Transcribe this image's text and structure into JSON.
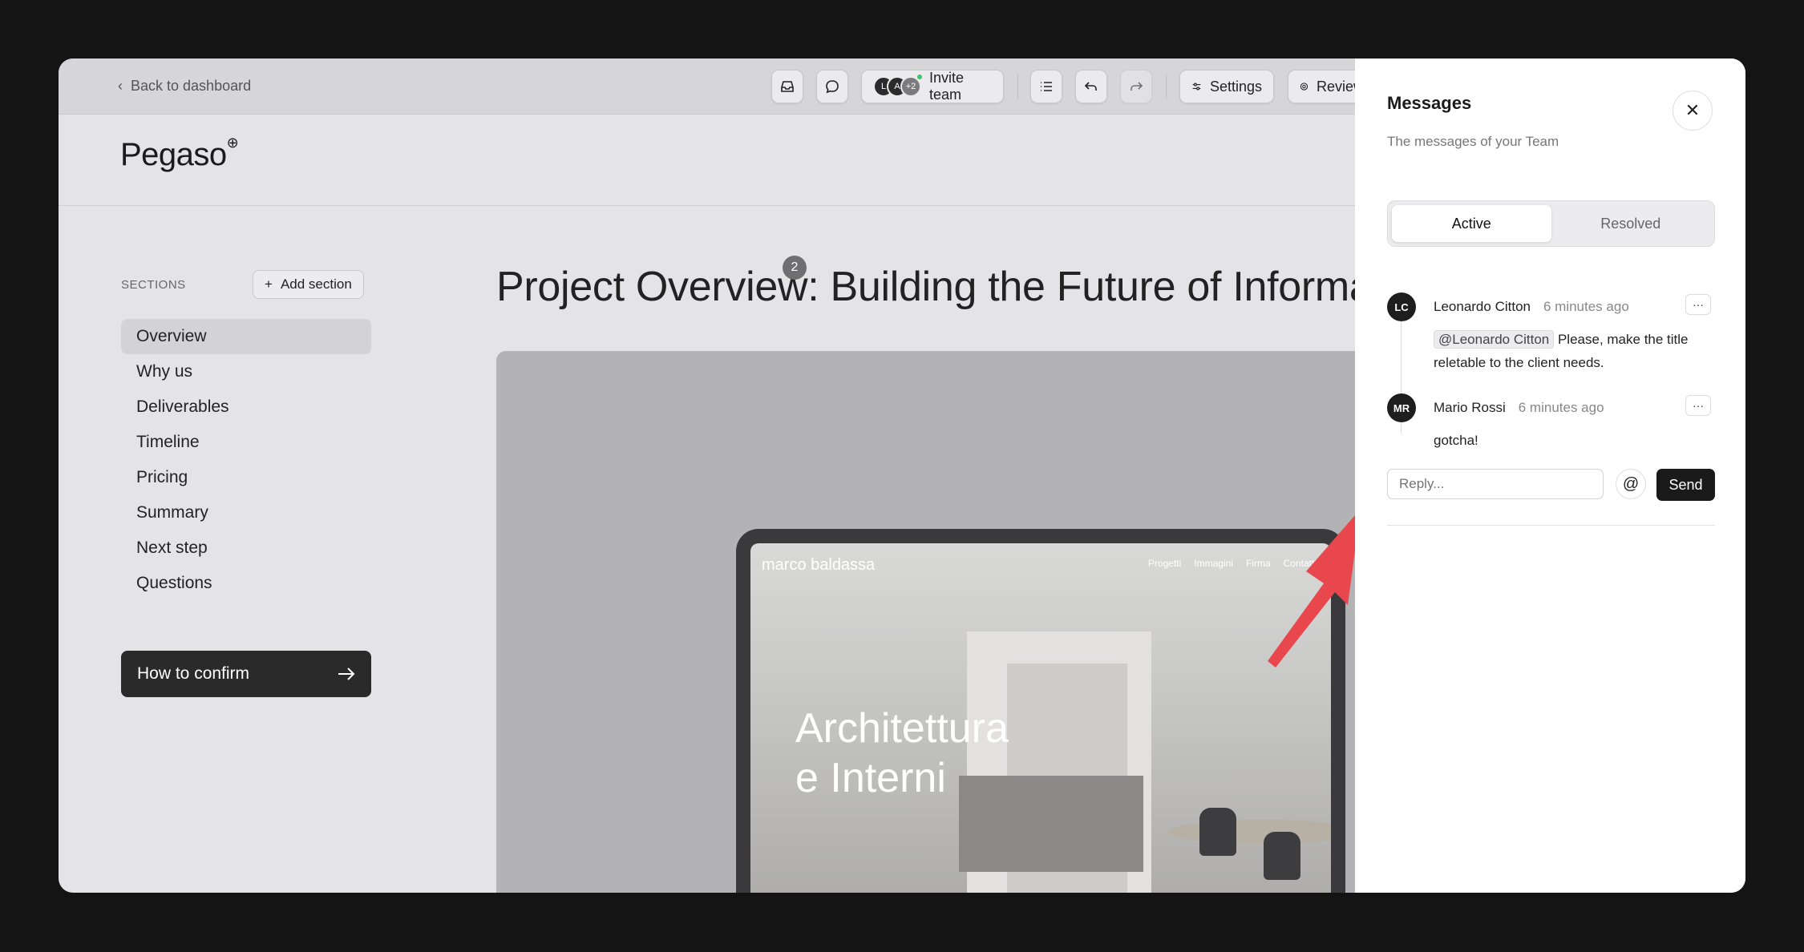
{
  "topbar": {
    "back_label": "Back to dashboard",
    "avatars": [
      "L",
      "A",
      "+2"
    ],
    "invite_label": "Invite team",
    "settings_label": "Settings",
    "review_label": "Review"
  },
  "brand": {
    "name": "Pegaso",
    "mark": "⊕"
  },
  "sidebar": {
    "sections_label": "SECTIONS",
    "add_section_label": "Add section",
    "items": [
      {
        "label": "Overview",
        "active": true
      },
      {
        "label": "Why us"
      },
      {
        "label": "Deliverables"
      },
      {
        "label": "Timeline"
      },
      {
        "label": "Pricing"
      },
      {
        "label": "Summary"
      },
      {
        "label": "Next step"
      },
      {
        "label": "Questions"
      }
    ],
    "confirm_label": "How to confirm"
  },
  "main": {
    "title": "Project Overview: Building the Future of Informat",
    "comment_count": "2",
    "hero": {
      "site_name": "marco baldassa",
      "site_nav": [
        "Progetti",
        "Immagini",
        "Firma",
        "Contatti"
      ],
      "headline_line1": "Architettura",
      "headline_line2": "e Interni"
    }
  },
  "messages": {
    "title": "Messages",
    "subtitle": "The messages of your Team",
    "tabs": [
      {
        "label": "Active",
        "selected": true
      },
      {
        "label": "Resolved",
        "selected": false
      }
    ],
    "items": [
      {
        "initials": "LC",
        "author": "Leonardo Citton",
        "time": "6 minutes ago",
        "mention": "@Leonardo Citton",
        "text": "Please, make the title reletable to the client needs."
      },
      {
        "initials": "MR",
        "author": "Mario Rossi",
        "time": "6 minutes ago",
        "text": "gotcha!"
      }
    ],
    "reply_placeholder": "Reply...",
    "send_label": "Send",
    "more_label": "···"
  },
  "colors": {
    "arrow": "#e8484d",
    "accent_dark": "#1a1a1a",
    "online": "#3fc26a"
  }
}
